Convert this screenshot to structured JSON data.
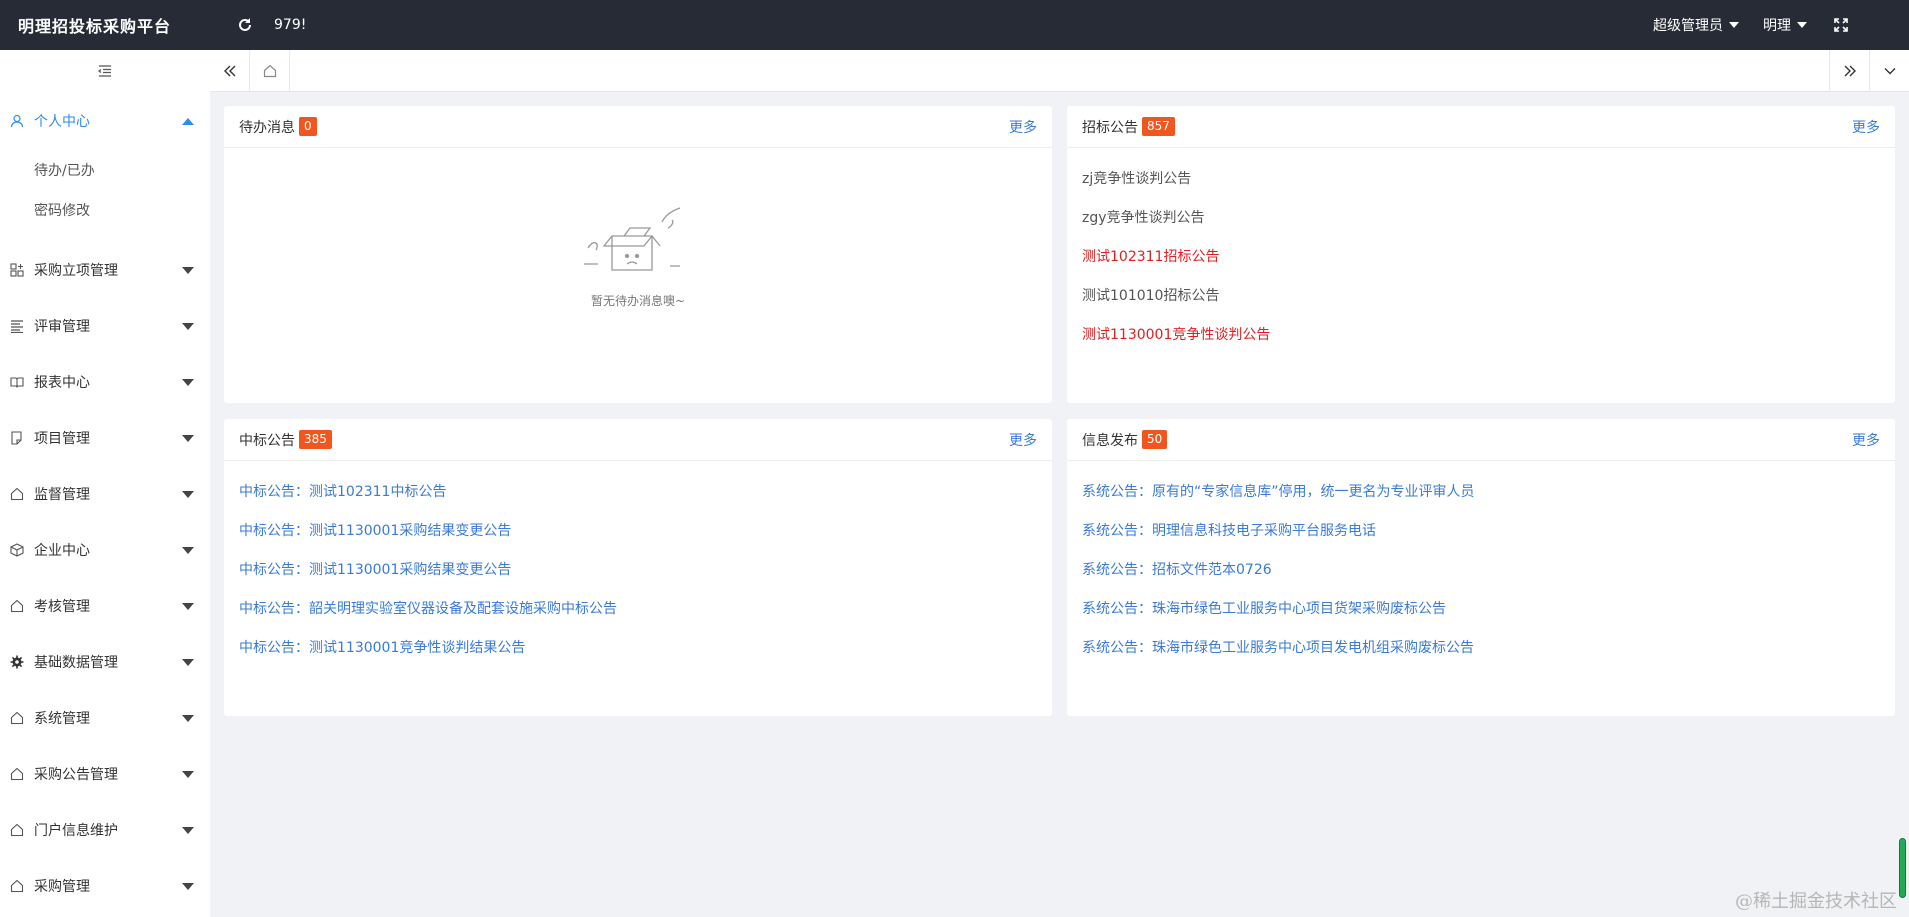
{
  "header": {
    "brand": "明理招投标采购平台",
    "count": "979!",
    "user_role": "超级管理员",
    "user_name": "明理"
  },
  "sidebar": {
    "items": [
      {
        "label": "个人中心",
        "icon": "user-icon",
        "open": true,
        "children": [
          "待办/已办",
          "密码修改"
        ]
      },
      {
        "label": "采购立项管理",
        "icon": "grid-plus-icon"
      },
      {
        "label": "评审管理",
        "icon": "list-icon"
      },
      {
        "label": "报表中心",
        "icon": "book-icon"
      },
      {
        "label": "项目管理",
        "icon": "document-icon"
      },
      {
        "label": "监督管理",
        "icon": "home-icon"
      },
      {
        "label": "企业中心",
        "icon": "cube-icon"
      },
      {
        "label": "考核管理",
        "icon": "home-icon"
      },
      {
        "label": "基础数据管理",
        "icon": "gear-icon"
      },
      {
        "label": "系统管理",
        "icon": "home-icon"
      },
      {
        "label": "采购公告管理",
        "icon": "home-icon"
      },
      {
        "label": "门户信息维护",
        "icon": "home-icon"
      },
      {
        "label": "采购管理",
        "icon": "home-icon"
      }
    ]
  },
  "panels": {
    "todo": {
      "title": "待办消息",
      "badge": "0",
      "more": "更多",
      "empty_text": "暂无待办消息噢~"
    },
    "bidding": {
      "title": "招标公告",
      "badge": "857",
      "more": "更多",
      "items": [
        {
          "text": "zj竞争性谈判公告",
          "color": "gray"
        },
        {
          "text": "zgy竞争性谈判公告",
          "color": "gray"
        },
        {
          "text": "测试102311招标公告",
          "color": "red"
        },
        {
          "text": "测试101010招标公告",
          "color": "gray"
        },
        {
          "text": "测试1130001竞争性谈判公告",
          "color": "red"
        }
      ]
    },
    "award": {
      "title": "中标公告",
      "badge": "385",
      "more": "更多",
      "items": [
        "中标公告：测试102311中标公告",
        "中标公告：测试1130001采购结果变更公告",
        "中标公告：测试1130001采购结果变更公告",
        "中标公告：韶关明理实验室仪器设备及配套设施采购中标公告",
        "中标公告：测试1130001竞争性谈判结果公告"
      ]
    },
    "info": {
      "title": "信息发布",
      "badge": "50",
      "more": "更多",
      "items": [
        "系统公告：原有的“专家信息库”停用，统一更名为专业评审人员",
        "系统公告：明理信息科技电子采购平台服务电话",
        "系统公告：招标文件范本0726",
        "系统公告：珠海市绿色工业服务中心项目货架采购废标公告",
        "系统公告：珠海市绿色工业服务中心项目发电机组采购废标公告"
      ]
    }
  },
  "watermark": "@稀土掘金技术社区",
  "colors": {
    "header_bg": "#262b35",
    "badge": "#f0561d",
    "link": "#3a7bd5",
    "red": "#e02020",
    "active": "#2d8cf0"
  }
}
